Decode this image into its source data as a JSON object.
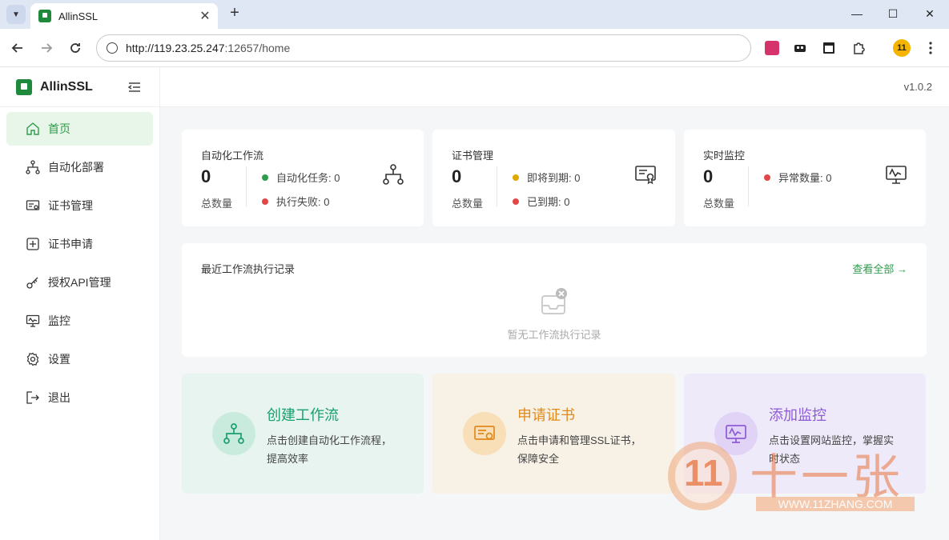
{
  "browser": {
    "tab_title": "AllinSSL",
    "url_host": "http://119.23.25.247",
    "url_rest": ":12657/home",
    "profile_badge": "11"
  },
  "app": {
    "name": "AllinSSL",
    "version": "v1.0.2"
  },
  "sidebar": {
    "items": [
      {
        "label": "首页",
        "icon": "home-icon"
      },
      {
        "label": "自动化部署",
        "icon": "workflow-icon"
      },
      {
        "label": "证书管理",
        "icon": "certificate-icon"
      },
      {
        "label": "证书申请",
        "icon": "plus-square-icon"
      },
      {
        "label": "授权API管理",
        "icon": "api-key-icon"
      },
      {
        "label": "监控",
        "icon": "monitor-icon"
      },
      {
        "label": "设置",
        "icon": "gear-icon"
      },
      {
        "label": "退出",
        "icon": "logout-icon"
      }
    ]
  },
  "stats": {
    "workflow": {
      "title": "自动化工作流",
      "count": "0",
      "count_label": "总数量",
      "line1": "自动化任务: 0",
      "line2": "执行失败: 0"
    },
    "cert": {
      "title": "证书管理",
      "count": "0",
      "count_label": "总数量",
      "line1": "即将到期: 0",
      "line2": "已到期: 0"
    },
    "monitor": {
      "title": "实时监控",
      "count": "0",
      "count_label": "总数量",
      "line1": "异常数量: 0"
    }
  },
  "recent": {
    "title": "最近工作流执行记录",
    "view_all": "查看全部 →",
    "empty": "暂无工作流执行记录"
  },
  "actions": {
    "create_workflow": {
      "title": "创建工作流",
      "desc": "点击创建自动化工作流程，提高效率"
    },
    "apply_cert": {
      "title": "申请证书",
      "desc": "点击申请和管理SSL证书，保障安全"
    },
    "add_monitor": {
      "title": "添加监控",
      "desc": "点击设置网站监控，掌握实时状态"
    }
  },
  "watermark": {
    "text": "十一张",
    "url": "WWW.11ZHANG.COM",
    "number": "11"
  },
  "colors": {
    "accent_green": "#2e9c4b",
    "warn_yellow": "#e0a800",
    "error_red": "#e04848",
    "purple": "#8e5bd6"
  }
}
